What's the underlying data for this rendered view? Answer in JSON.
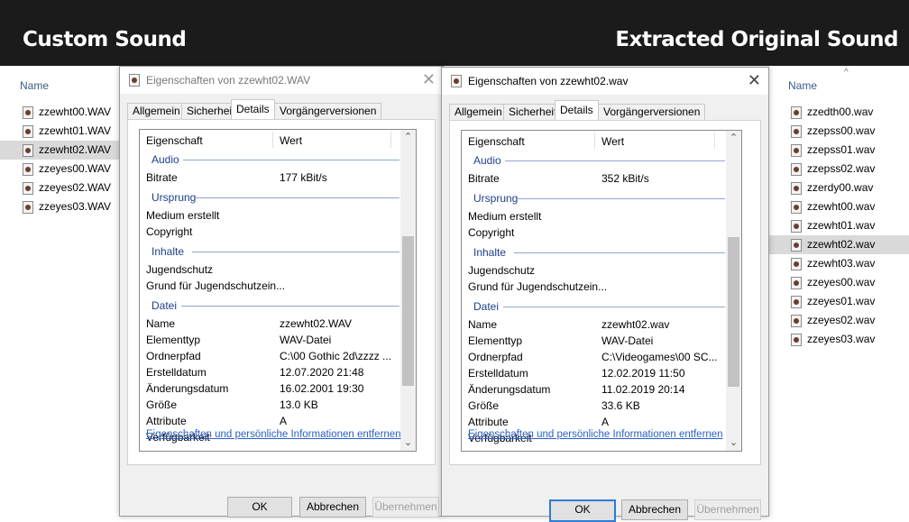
{
  "banner": {
    "left_label": "Custom Sound",
    "right_label": "Extracted Original Sound"
  },
  "left_explorer": {
    "column_header": "Name",
    "files": [
      {
        "name": "zzewht00.WAV",
        "selected": false
      },
      {
        "name": "zzewht01.WAV",
        "selected": false
      },
      {
        "name": "zzewht02.WAV",
        "selected": true
      },
      {
        "name": "zzeyes00.WAV",
        "selected": false
      },
      {
        "name": "zzeyes02.WAV",
        "selected": false
      },
      {
        "name": "zzeyes03.WAV",
        "selected": false
      }
    ]
  },
  "right_explorer": {
    "column_header": "Name",
    "sort_indicator": "^",
    "files": [
      {
        "name": "zzedth00.wav",
        "selected": false
      },
      {
        "name": "zzepss00.wav",
        "selected": false
      },
      {
        "name": "zzepss01.wav",
        "selected": false
      },
      {
        "name": "zzepss02.wav",
        "selected": false
      },
      {
        "name": "zzerdy00.wav",
        "selected": false
      },
      {
        "name": "zzewht00.wav",
        "selected": false
      },
      {
        "name": "zzewht01.wav",
        "selected": false
      },
      {
        "name": "zzewht02.wav",
        "selected": true
      },
      {
        "name": "zzewht03.wav",
        "selected": false
      },
      {
        "name": "zzeyes00.wav",
        "selected": false
      },
      {
        "name": "zzeyes01.wav",
        "selected": false
      },
      {
        "name": "zzeyes02.wav",
        "selected": false
      },
      {
        "name": "zzeyes03.wav",
        "selected": false
      }
    ]
  },
  "dialog_left": {
    "title": "Eigenschaften von zzewht02.WAV",
    "close": "✕",
    "tabs": [
      "Allgemein",
      "Sicherheit",
      "Details",
      "Vorgängerversionen"
    ],
    "active_tab": 2,
    "header_property": "Eigenschaft",
    "header_value": "Wert",
    "audio_group": "Audio",
    "bitrate_label": "Bitrate",
    "bitrate_value": "177 kBit/s",
    "origin_group": "Ursprung",
    "media_created_label": "Medium erstellt",
    "copyright_label": "Copyright",
    "content_group": "Inhalte",
    "parental_label": "Jugendschutz",
    "parental_reason_label": "Grund für Jugendschutzein...",
    "file_group": "Datei",
    "name_label": "Name",
    "name_value": "zzewht02.WAV",
    "type_label": "Elementtyp",
    "type_value": "WAV-Datei",
    "folder_label": "Ordnerpfad",
    "folder_value": "C:\\00 Gothic 2d\\zzzz ...",
    "created_label": "Erstelldatum",
    "created_value": "12.07.2020 21:48",
    "modified_label": "Änderungsdatum",
    "modified_value": "16.02.2001 19:30",
    "size_label": "Größe",
    "size_value": "13.0 KB",
    "attr_label": "Attribute",
    "attr_value": "A",
    "availability_label": "Verfügbarkeit",
    "remove_link": "Eigenschaften und persönliche Informationen entfernen",
    "ok": "OK",
    "cancel": "Abbrechen",
    "apply": "Übernehmen"
  },
  "dialog_right": {
    "title": "Eigenschaften von zzewht02.wav",
    "close": "✕",
    "tabs": [
      "Allgemein",
      "Sicherheit",
      "Details",
      "Vorgängerversionen"
    ],
    "active_tab": 2,
    "header_property": "Eigenschaft",
    "header_value": "Wert",
    "audio_group": "Audio",
    "bitrate_label": "Bitrate",
    "bitrate_value": "352 kBit/s",
    "origin_group": "Ursprung",
    "media_created_label": "Medium erstellt",
    "copyright_label": "Copyright",
    "content_group": "Inhalte",
    "parental_label": "Jugendschutz",
    "parental_reason_label": "Grund für Jugendschutzein...",
    "file_group": "Datei",
    "name_label": "Name",
    "name_value": "zzewht02.wav",
    "type_label": "Elementtyp",
    "type_value": "WAV-Datei",
    "folder_label": "Ordnerpfad",
    "folder_value": "C:\\Videogames\\00 SC...",
    "created_label": "Erstelldatum",
    "created_value": "12.02.2019 11:50",
    "modified_label": "Änderungsdatum",
    "modified_value": "11.02.2019 20:14",
    "size_label": "Größe",
    "size_value": "33.6 KB",
    "attr_label": "Attribute",
    "attr_value": "A",
    "availability_label": "Verfügbarkeit",
    "remove_link": "Eigenschaften und persönliche Informationen entfernen",
    "ok": "OK",
    "cancel": "Abbrechen",
    "apply": "Übernehmen"
  }
}
